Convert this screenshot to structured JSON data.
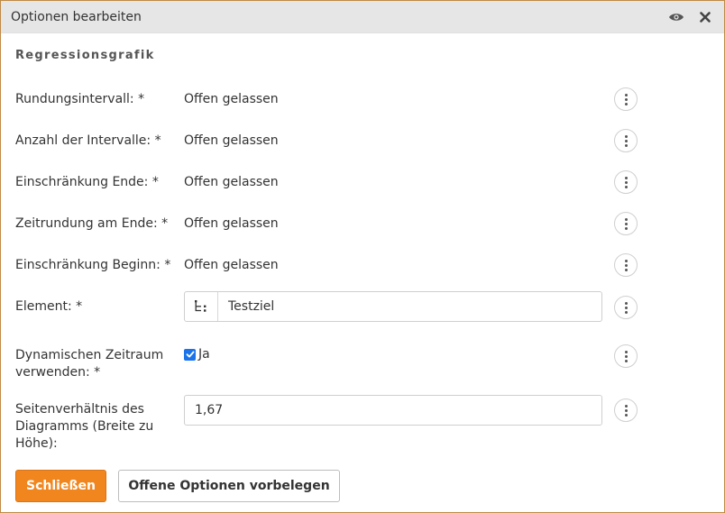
{
  "dialog": {
    "title": "Optionen bearbeiten",
    "icons": {
      "view": "eye-icon",
      "close": "close-icon"
    }
  },
  "section": {
    "title": "Regressionsgrafik"
  },
  "rows": [
    {
      "label": "Rundungsintervall: *",
      "value": "Offen gelassen"
    },
    {
      "label": "Anzahl der Intervalle: *",
      "value": "Offen gelassen"
    },
    {
      "label": "Einschränkung Ende: *",
      "value": "Offen gelassen"
    },
    {
      "label": "Zeitrundung am Ende: *",
      "value": "Offen gelassen"
    },
    {
      "label": "Einschränkung Beginn: *",
      "value": "Offen gelassen"
    }
  ],
  "element": {
    "label": "Element: *",
    "value": "Testziel",
    "icon": "tree-icon"
  },
  "dynamic": {
    "label": "Dynamischen Zeitraum verwenden: *",
    "checkbox_label": "Ja",
    "checked": true
  },
  "ratio": {
    "label": "Seitenverhältnis des Diagramms (Breite zu Höhe):",
    "value": "1,67"
  },
  "buttons": {
    "close": "Schließen",
    "prefill": "Offene Optionen vorbelegen"
  },
  "colors": {
    "accent": "#f0861d",
    "checkbox": "#1a73e8",
    "border": "#c08a45"
  }
}
